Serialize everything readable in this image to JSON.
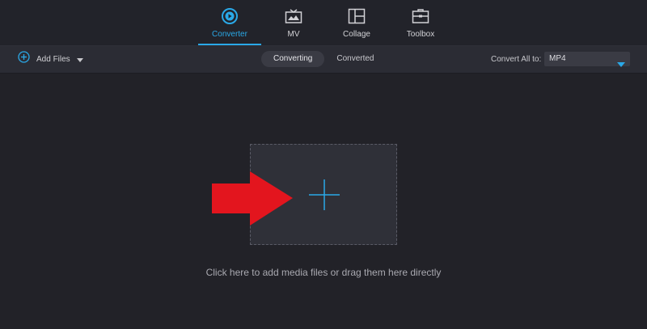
{
  "nav": {
    "tabs": [
      {
        "label": "Converter",
        "icon": "converter-icon",
        "active": true
      },
      {
        "label": "MV",
        "icon": "mv-icon",
        "active": false
      },
      {
        "label": "Collage",
        "icon": "collage-icon",
        "active": false
      },
      {
        "label": "Toolbox",
        "icon": "toolbox-icon",
        "active": false
      }
    ]
  },
  "toolbar": {
    "add_files_label": "Add Files",
    "segments": [
      {
        "label": "Converting",
        "active": true
      },
      {
        "label": "Converted",
        "active": false
      }
    ],
    "convert_all_label": "Convert All to:",
    "format_value": "MP4"
  },
  "main": {
    "hint": "Click here to add media files or drag them here directly"
  },
  "colors": {
    "accent": "#2aa9e8",
    "background": "#222228",
    "toolbar": "#2b2c34",
    "arrow": "#e3151e"
  }
}
